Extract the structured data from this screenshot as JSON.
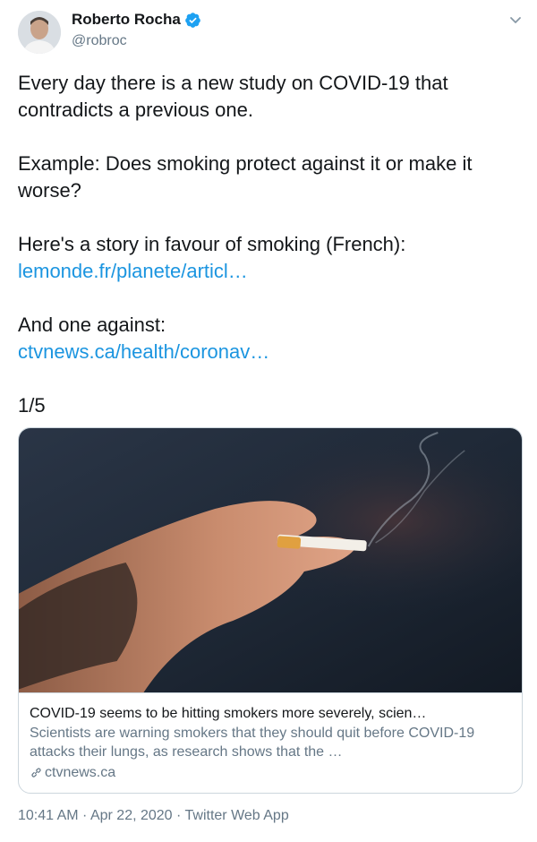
{
  "author": {
    "name": "Roberto Rocha",
    "handle": "@robroc",
    "verified_icon": "verified-badge-icon",
    "avatar": "avatar"
  },
  "tweet": {
    "paragraphs": [
      "Every day there is a new study on COVID-19 that contradicts a previous one.",
      "Example: Does smoking protect against it or make it worse?"
    ],
    "favour_text": "Here's a story in favour of smoking (French):",
    "favour_link": "lemonde.fr/planete/articl…",
    "against_text": "And one against:",
    "against_link": "ctvnews.ca/health/coronav…",
    "thread_count": "1/5"
  },
  "card": {
    "title": "COVID-19 seems to be hitting smokers more severely, scien…",
    "description": "Scientists are warning smokers that they should quit before COVID-19 attacks their lungs, as research shows that the …",
    "domain": "ctvnews.ca",
    "domain_icon": "link-icon"
  },
  "meta": {
    "time": "10:41 AM",
    "sep1": " · ",
    "date": "Apr 22, 2020",
    "sep2": " · ",
    "source": "Twitter Web App"
  },
  "colors": {
    "link": "#1b95e0",
    "secondary": "#657786",
    "verified": "#1da1f2"
  },
  "icons": [
    "chevron-down-icon",
    "verified-badge-icon",
    "link-icon"
  ]
}
